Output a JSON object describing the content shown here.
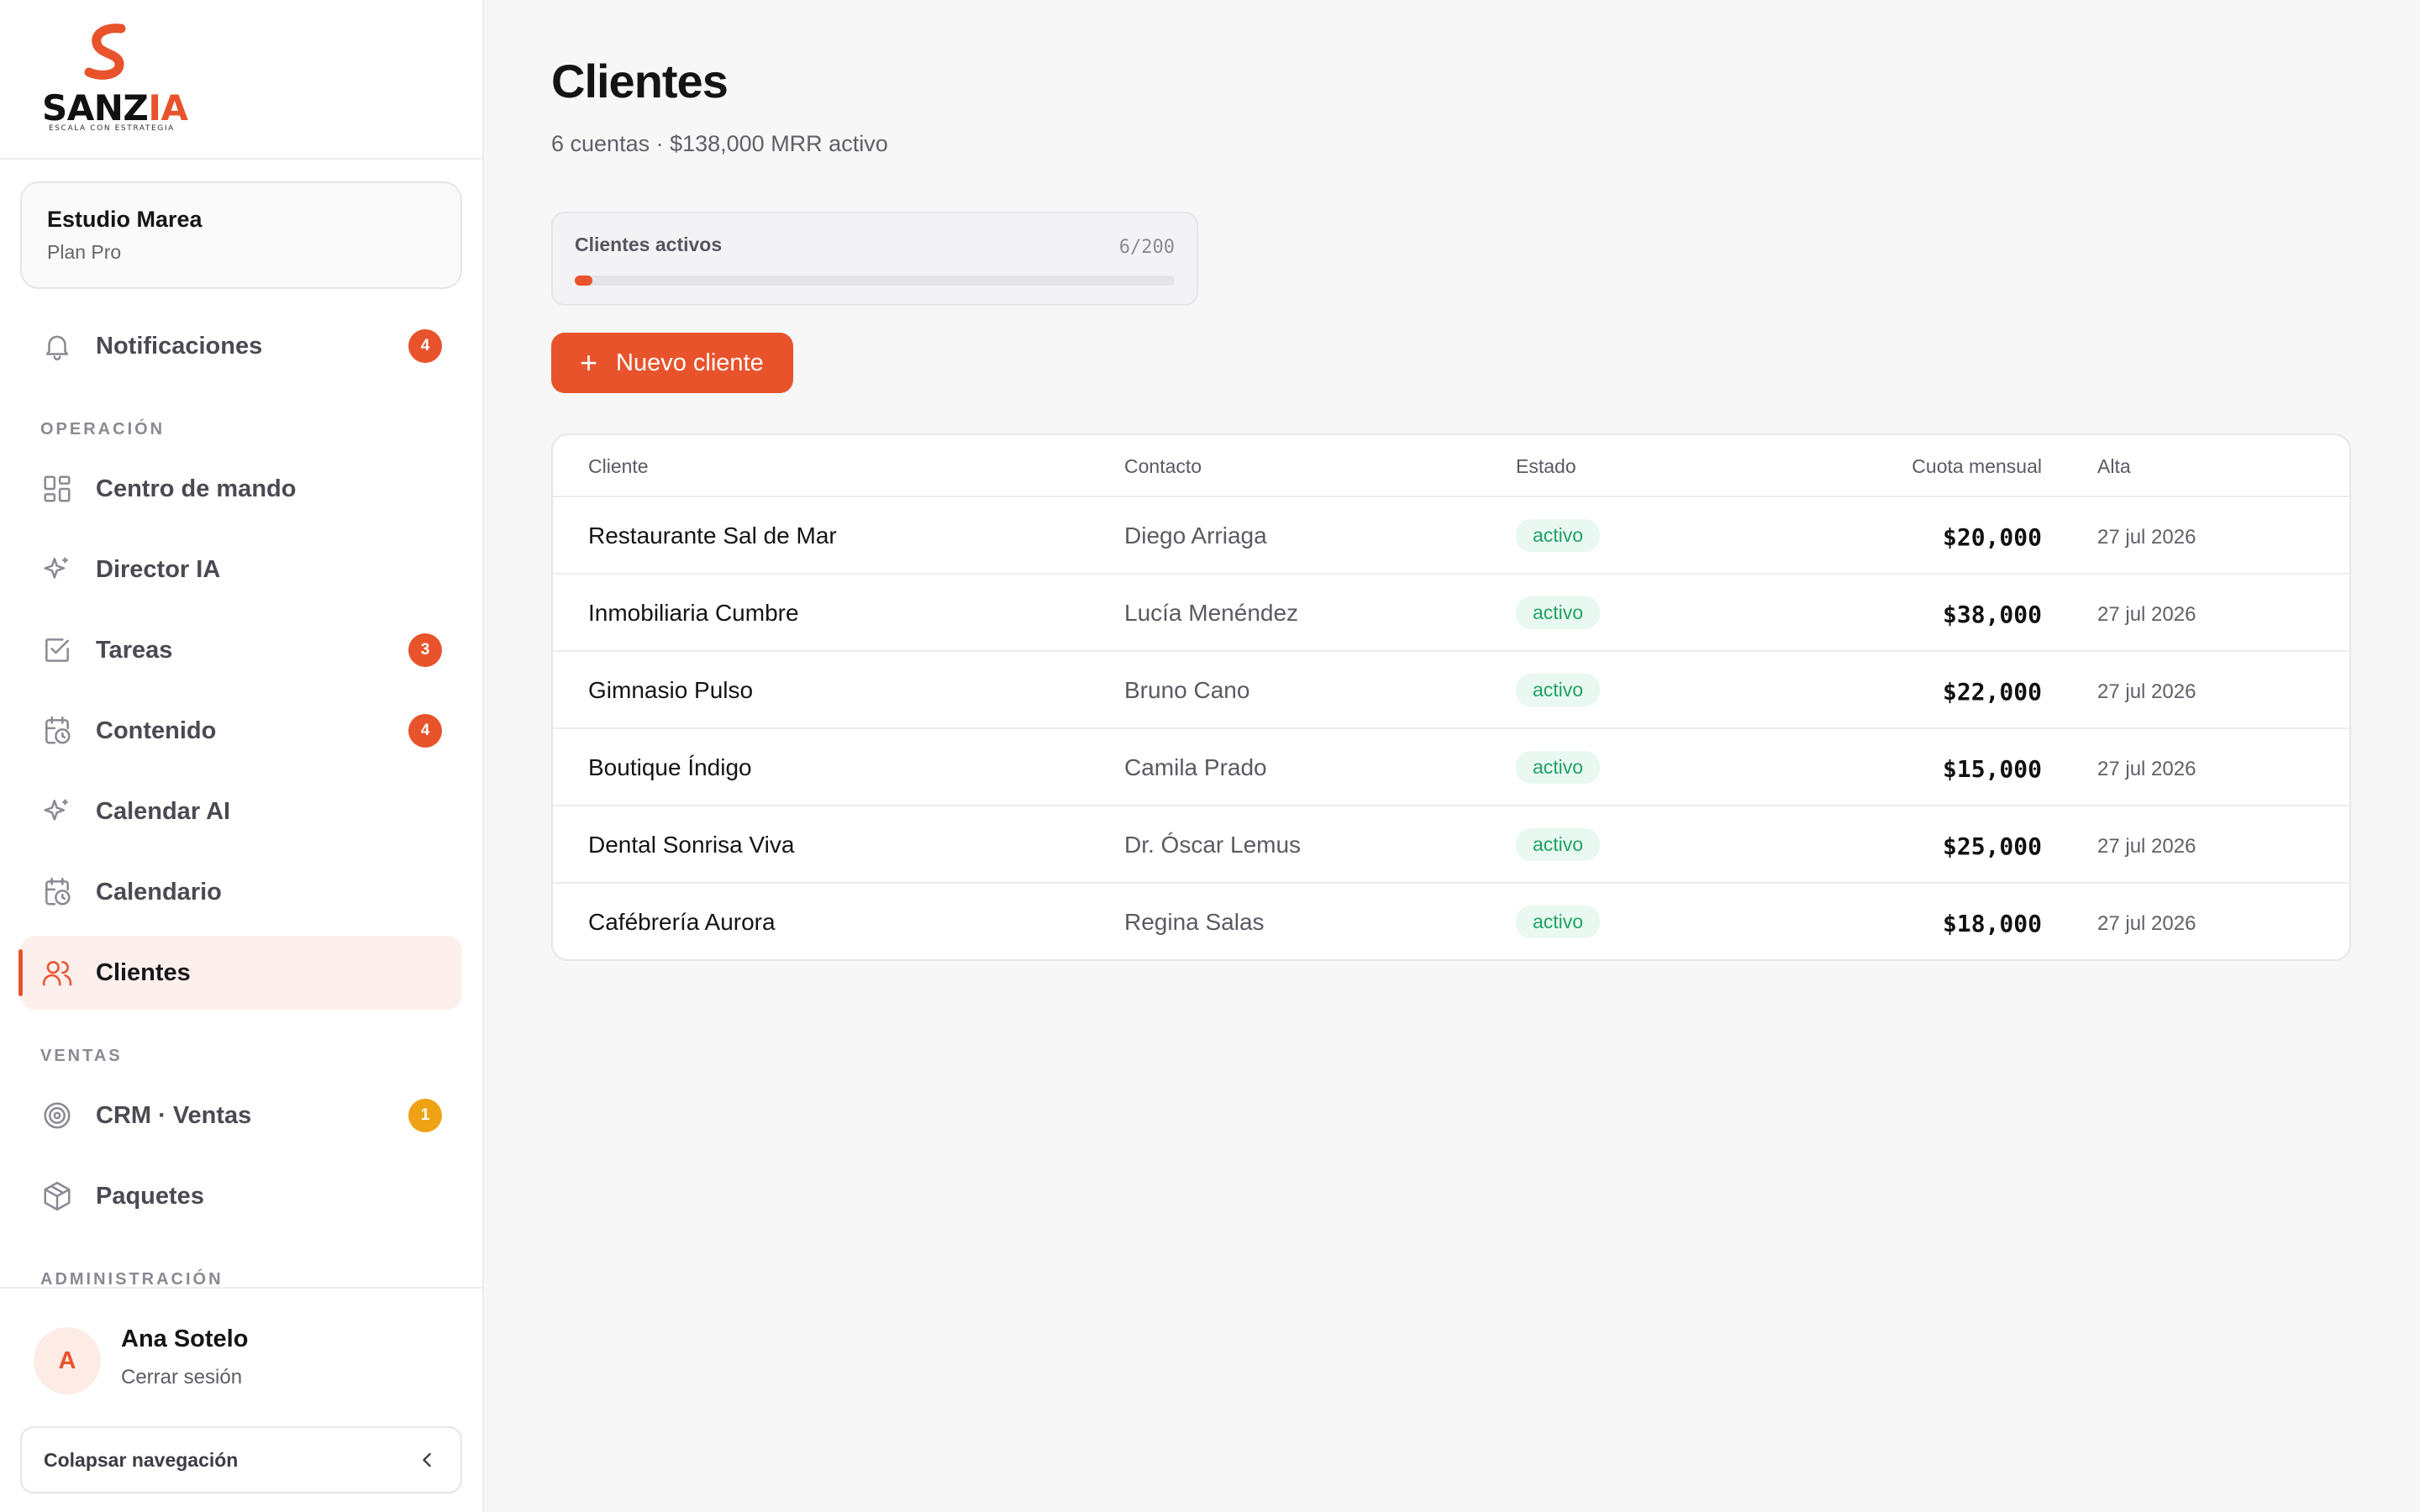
{
  "brand": {
    "logo_word_main": "SANZ",
    "logo_word_accent": "IA",
    "tagline": "ESCALA CON ESTRATEGIA",
    "accent_color": "#e8532c"
  },
  "workspace": {
    "name": "Estudio Marea",
    "plan": "Plan Pro"
  },
  "sidebar": {
    "notifications": {
      "label": "Notificaciones",
      "badge": "4",
      "icon": "bell-icon"
    },
    "sections": {
      "operacion": "OPERACIÓN",
      "ventas": "VENTAS",
      "administracion": "ADMINISTRACIÓN"
    },
    "items": [
      {
        "label": "Centro de mando",
        "icon": "grid-icon",
        "badge": ""
      },
      {
        "label": "Director IA",
        "icon": "sparkle-icon",
        "badge": ""
      },
      {
        "label": "Tareas",
        "icon": "checkbox-icon",
        "badge": "3"
      },
      {
        "label": "Contenido",
        "icon": "calendar-clock-icon",
        "badge": "4"
      },
      {
        "label": "Calendar AI",
        "icon": "sparkle-icon",
        "badge": ""
      },
      {
        "label": "Calendario",
        "icon": "calendar-clock-icon",
        "badge": ""
      },
      {
        "label": "Clientes",
        "icon": "users-icon",
        "badge": "",
        "active": true
      },
      {
        "label": "CRM · Ventas",
        "icon": "target-icon",
        "badge": "1"
      },
      {
        "label": "Paquetes",
        "icon": "package-icon",
        "badge": ""
      }
    ]
  },
  "user": {
    "initial": "A",
    "name": "Ana Sotelo",
    "logout_label": "Cerrar sesión"
  },
  "collapse_label": "Colapsar navegación",
  "page": {
    "title": "Clientes",
    "subtitle": "6 cuentas · $138,000 MRR activo"
  },
  "quota": {
    "label": "Clientes activos",
    "count": "6/200",
    "fraction": 0.03
  },
  "new_button_label": "Nuevo cliente",
  "table": {
    "headers": [
      "Cliente",
      "Contacto",
      "Estado",
      "Cuota mensual",
      "Alta"
    ],
    "rows": [
      {
        "cliente": "Restaurante Sal de Mar",
        "contacto": "Diego Arriaga",
        "estado": "activo",
        "cuota": "$20,000",
        "alta": "27 jul 2026"
      },
      {
        "cliente": "Inmobiliaria Cumbre",
        "contacto": "Lucía Menéndez",
        "estado": "activo",
        "cuota": "$38,000",
        "alta": "27 jul 2026"
      },
      {
        "cliente": "Gimnasio Pulso",
        "contacto": "Bruno Cano",
        "estado": "activo",
        "cuota": "$22,000",
        "alta": "27 jul 2026"
      },
      {
        "cliente": "Boutique Índigo",
        "contacto": "Camila Prado",
        "estado": "activo",
        "cuota": "$15,000",
        "alta": "27 jul 2026"
      },
      {
        "cliente": "Dental Sonrisa Viva",
        "contacto": "Dr. Óscar Lemus",
        "estado": "activo",
        "cuota": "$25,000",
        "alta": "27 jul 2026"
      },
      {
        "cliente": "Cafébrería Aurora",
        "contacto": "Regina Salas",
        "estado": "activo",
        "cuota": "$18,000",
        "alta": "27 jul 2026"
      }
    ]
  }
}
